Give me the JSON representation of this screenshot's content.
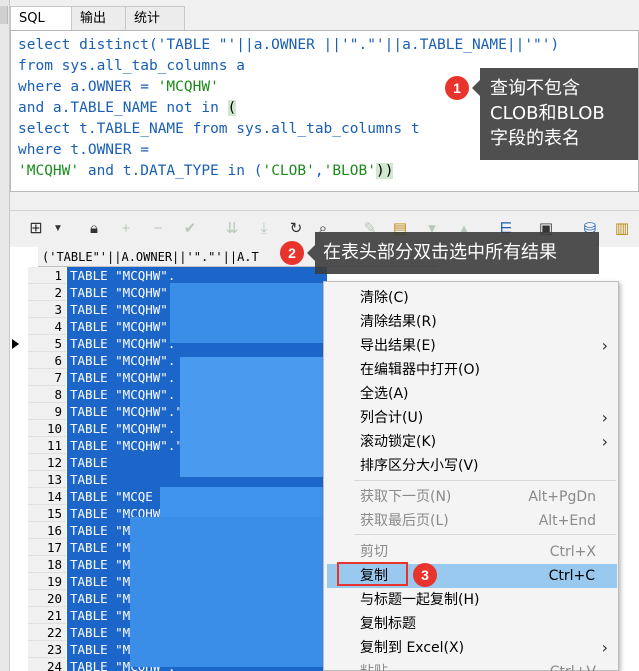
{
  "tabs": [
    {
      "label": "SQL"
    },
    {
      "label": "输出"
    },
    {
      "label": "统计"
    }
  ],
  "sql": {
    "line1_kw": "select distinct",
    "line1_rest": "('TABLE \"'||a.OWNER ||'\".\"'||a.TABLE_NAME||'\"')",
    "line2": "from sys.all_tab_columns a",
    "line3_kw": "where",
    "line3_rest": " a.OWNER = ",
    "line3_str": "'MCQHW'",
    "line4_kw": "and",
    "line4_rest": " a.TABLE_NAME ",
    "line4_kw2": "not in",
    "line4_paren": "(",
    "line5_kw": "select",
    "line5_rest": " t.TABLE_NAME ",
    "line5_kw2": "from",
    "line5_rest2": " sys.all_tab_columns t",
    "line6_kw": "where",
    "line6_rest": " t.OWNER =",
    "line7_str": "'MCQHW'",
    "line7_kw": " and",
    "line7_rest": " t.DATA_TYPE ",
    "line7_kw2": "in",
    "line7_tail_a": " (",
    "line7_str2": "'CLOB'",
    "line7_comma": ",",
    "line7_str3": "'BLOB'",
    "line7_tail_b": "))"
  },
  "callouts": {
    "c1_num": "1",
    "c1_text_1": "查询不包含",
    "c1_text_2": "CLOB和BLOB",
    "c1_text_3": "字段的表名",
    "c2_num": "2",
    "c2_text": "在表头部分双击选中所有结果",
    "c3_num": "3"
  },
  "grid": {
    "header": "('TABLE\"'||A.OWNER||'\".\"'||A.T",
    "rows": [
      {
        "num": "1",
        "text": "TABLE \"MCQHW\"."
      },
      {
        "num": "2",
        "text": "TABLE \"MCQHW\"."
      },
      {
        "num": "3",
        "text": "TABLE \"MCQHW\"."
      },
      {
        "num": "4",
        "text": "TABLE \"MCQHW\"."
      },
      {
        "num": "5",
        "text": "TABLE \"MCQHW\"."
      },
      {
        "num": "6",
        "text": "TABLE \"MCQHW\"."
      },
      {
        "num": "7",
        "text": "TABLE \"MCQHW\"."
      },
      {
        "num": "8",
        "text": "TABLE \"MCQHW\"."
      },
      {
        "num": "9",
        "text": "TABLE \"MCQHW\".\""
      },
      {
        "num": "10",
        "text": "TABLE \"MCQHW\"."
      },
      {
        "num": "11",
        "text": "TABLE \"MCQHW\".\"DIS_ZJ\""
      },
      {
        "num": "12",
        "text": "TABLE"
      },
      {
        "num": "13",
        "text": "TABLE"
      },
      {
        "num": "14",
        "text": "TABLE \"MCQE"
      },
      {
        "num": "15",
        "text": "TABLE \"MCQHW"
      },
      {
        "num": "16",
        "text": "TABLE \"MCQ"
      },
      {
        "num": "17",
        "text": "TABLE \"MCQH"
      },
      {
        "num": "18",
        "text": "TABLE \"MCQHW"
      },
      {
        "num": "19",
        "text": "TABLE \"MCQHW\""
      },
      {
        "num": "20",
        "text": "TABLE \"MCQHW\""
      },
      {
        "num": "21",
        "text": "TABLE \"MCQHW\"."
      },
      {
        "num": "22",
        "text": "TABLE \"MCQHW\".\""
      },
      {
        "num": "23",
        "text": "TABLE \"MCQHW\"."
      },
      {
        "num": "24",
        "text": "TABLE \"MCQHW\"."
      }
    ]
  },
  "menu": {
    "items": [
      {
        "label": "清除(C)",
        "shortcut": "",
        "submenu": false,
        "disabled": false
      },
      {
        "label": "清除结果(R)",
        "shortcut": "",
        "submenu": false,
        "disabled": false
      },
      {
        "label": "导出结果(E)",
        "shortcut": "",
        "submenu": true,
        "disabled": false
      },
      {
        "label": "在编辑器中打开(O)",
        "shortcut": "",
        "submenu": false,
        "disabled": false
      },
      {
        "label": "全选(A)",
        "shortcut": "",
        "submenu": false,
        "disabled": false
      },
      {
        "label": "列合计(U)",
        "shortcut": "",
        "submenu": true,
        "disabled": false
      },
      {
        "label": "滚动锁定(K)",
        "shortcut": "",
        "submenu": true,
        "disabled": false
      },
      {
        "label": "排序区分大小写(V)",
        "shortcut": "",
        "submenu": false,
        "disabled": false
      },
      {
        "label": "获取下一页(N)",
        "shortcut": "Alt+PgDn",
        "submenu": false,
        "disabled": true
      },
      {
        "label": "获取最后页(L)",
        "shortcut": "Alt+End",
        "submenu": false,
        "disabled": true
      },
      {
        "label": "剪切",
        "shortcut": "Ctrl+X",
        "submenu": false,
        "disabled": true
      },
      {
        "label": "复制",
        "shortcut": "Ctrl+C",
        "submenu": false,
        "disabled": false
      },
      {
        "label": "与标题一起复制(H)",
        "shortcut": "",
        "submenu": false,
        "disabled": false
      },
      {
        "label": "复制标题",
        "shortcut": "",
        "submenu": false,
        "disabled": false
      },
      {
        "label": "复制到 Excel(X)",
        "shortcut": "",
        "submenu": true,
        "disabled": false
      },
      {
        "label": "粘贴",
        "shortcut": "Ctrl+V",
        "submenu": false,
        "disabled": true
      }
    ],
    "selected_label": "复制"
  },
  "colors": {
    "selection": "#1c66c9",
    "menu_highlight": "#99c9ef",
    "badge": "#e8342d",
    "keyword": "#1a5fb4",
    "string": "#1b8a1b"
  }
}
